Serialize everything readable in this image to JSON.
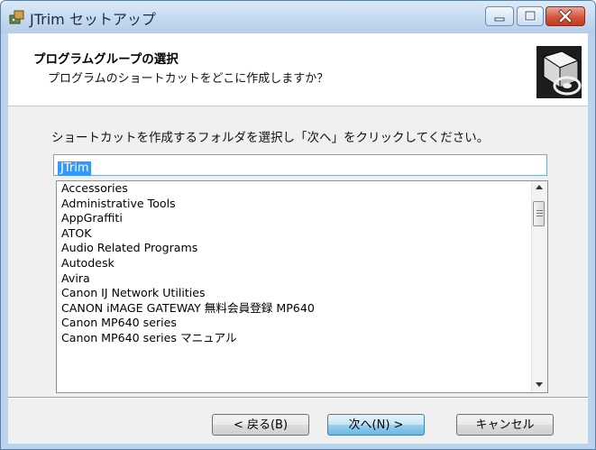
{
  "window": {
    "title": "JTrim セットアップ"
  },
  "header": {
    "title": "プログラムグループの選択",
    "subtitle": "プログラムのショートカットをどこに作成しますか？"
  },
  "body": {
    "instruction": "ショートカットを作成するフォルダを選択し「次へ」をクリックしてください。",
    "folder_input_value": "JTrim",
    "program_groups": [
      "Accessories",
      "Administrative Tools",
      "AppGraffiti",
      "ATOK",
      "Audio Related Programs",
      "Autodesk",
      "Avira",
      "Canon IJ Network Utilities",
      "CANON iMAGE GATEWAY 無料会員登録 MP640",
      "Canon MP640 series",
      "Canon MP640 series マニュアル"
    ]
  },
  "buttons": {
    "back": "< 戻る(B)",
    "next": "次へ(N) >",
    "cancel": "キャンセル"
  },
  "icons": {
    "app": "installer-icon",
    "setup_logo": "computer-install-icon",
    "minimize": "minimize-icon",
    "maximize": "maximize-icon",
    "close": "close-icon"
  }
}
